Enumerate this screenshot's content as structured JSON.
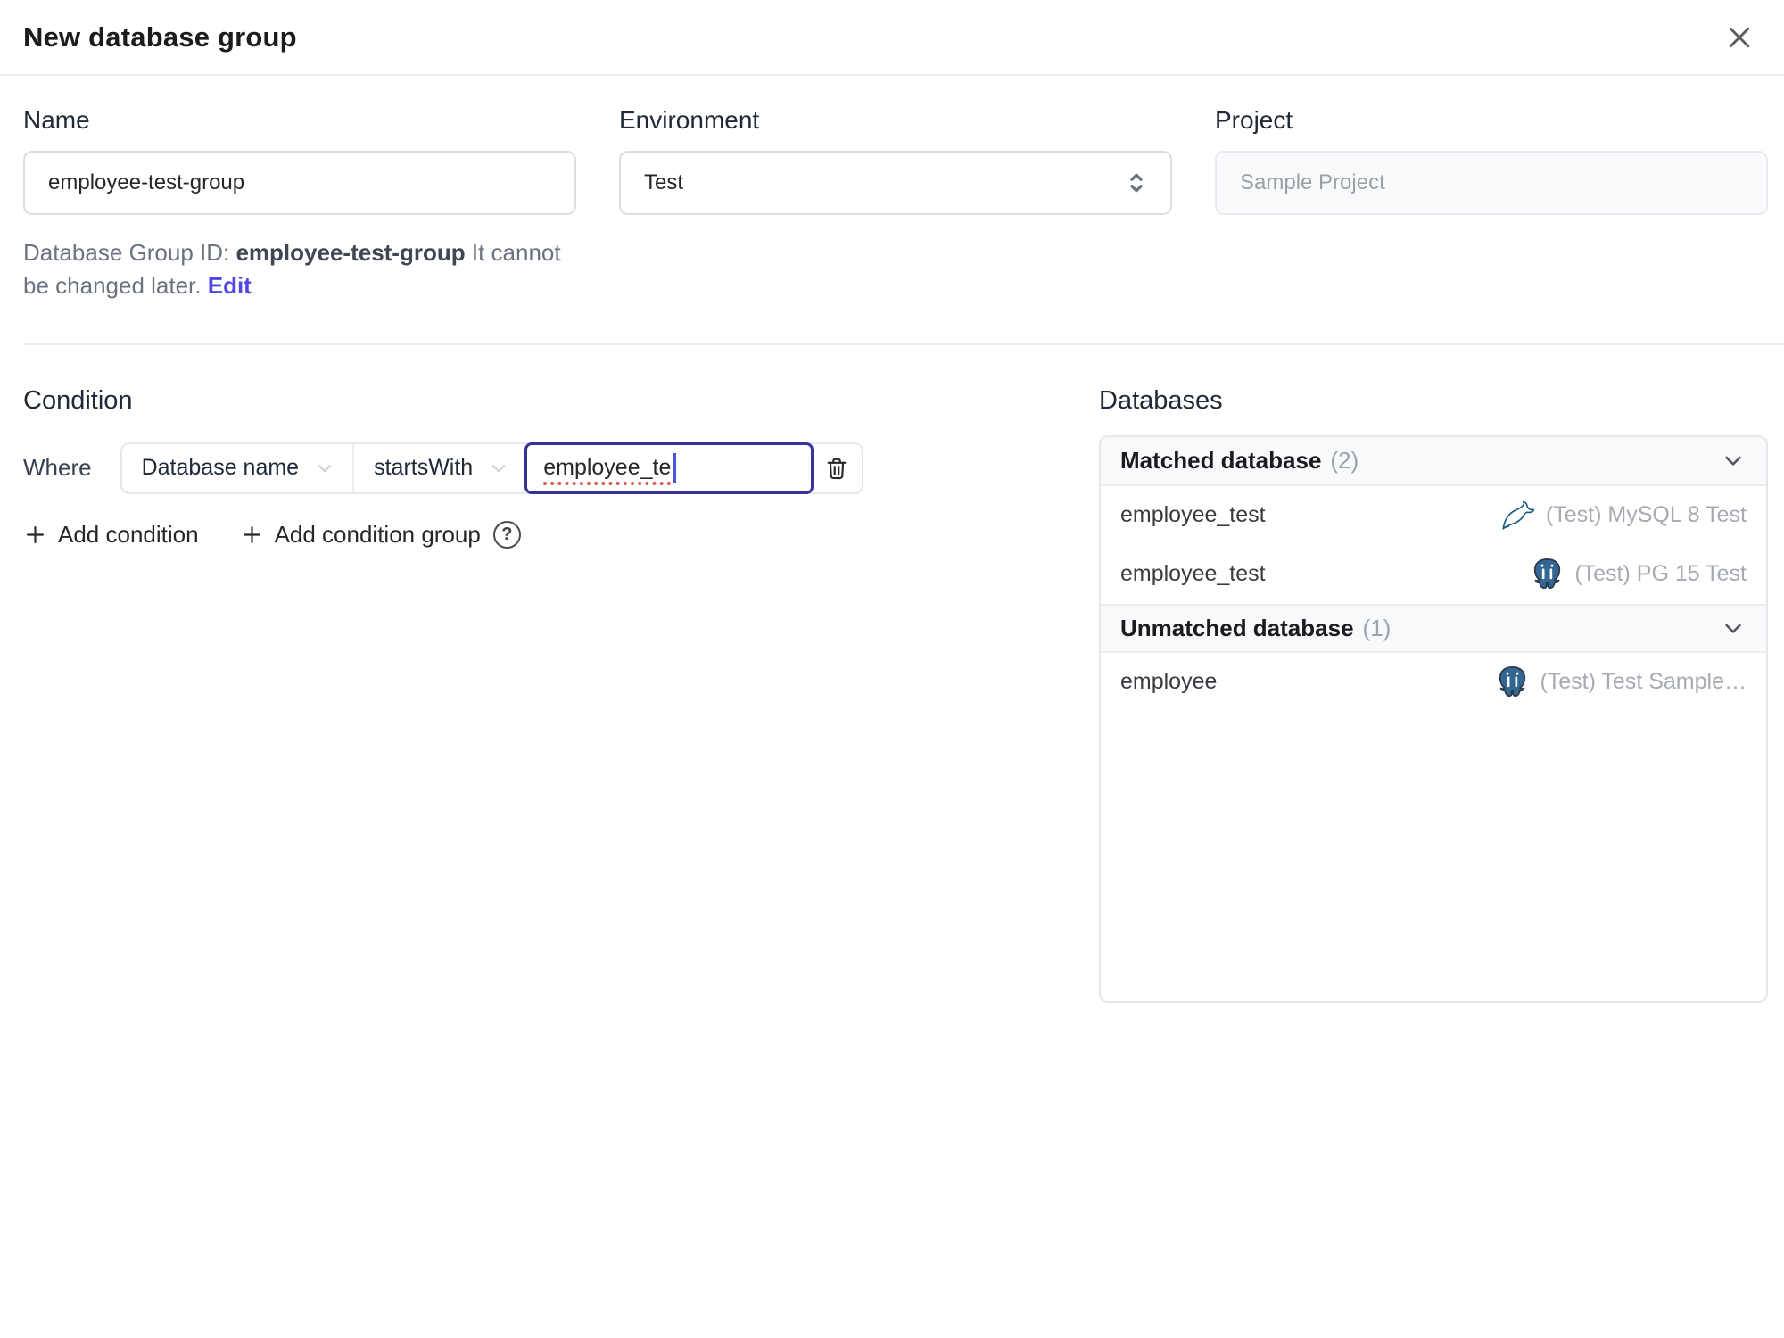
{
  "colors": {
    "accent": "#4f46e5",
    "focus_border": "#38339b",
    "caret": "#4a51da",
    "spellcheck_underline": "#df5b4d",
    "mysql_icon": "#13577b",
    "postgres_icon": "#336791"
  },
  "icons": {
    "help_glyph": "?"
  },
  "dialog": {
    "title": "New database group"
  },
  "form": {
    "name": {
      "label": "Name",
      "value": "employee-test-group"
    },
    "environment": {
      "label": "Environment",
      "value": "Test"
    },
    "project": {
      "label": "Project",
      "value": "Sample Project"
    },
    "id_note": {
      "prefix": "Database Group ID:",
      "id": "employee-test-group",
      "suffix": "It cannot be changed later.",
      "edit_label": "Edit"
    }
  },
  "condition": {
    "heading": "Condition",
    "where_label": "Where",
    "field_selected": "Database name",
    "operator_selected": "startsWith",
    "value": "employee_te",
    "add_condition": "Add condition",
    "add_condition_group": "Add condition group"
  },
  "databases": {
    "heading": "Databases",
    "matched": {
      "title": "Matched database",
      "count": "(2)",
      "rows": [
        {
          "name": "employee_test",
          "engine": "mysql",
          "instance": "(Test) MySQL 8 Test"
        },
        {
          "name": "employee_test",
          "engine": "postgresql",
          "instance": "(Test) PG 15 Test"
        }
      ]
    },
    "unmatched": {
      "title": "Unmatched database",
      "count": "(1)",
      "rows": [
        {
          "name": "employee",
          "engine": "postgresql",
          "instance": "(Test) Test Sample…"
        }
      ]
    }
  }
}
